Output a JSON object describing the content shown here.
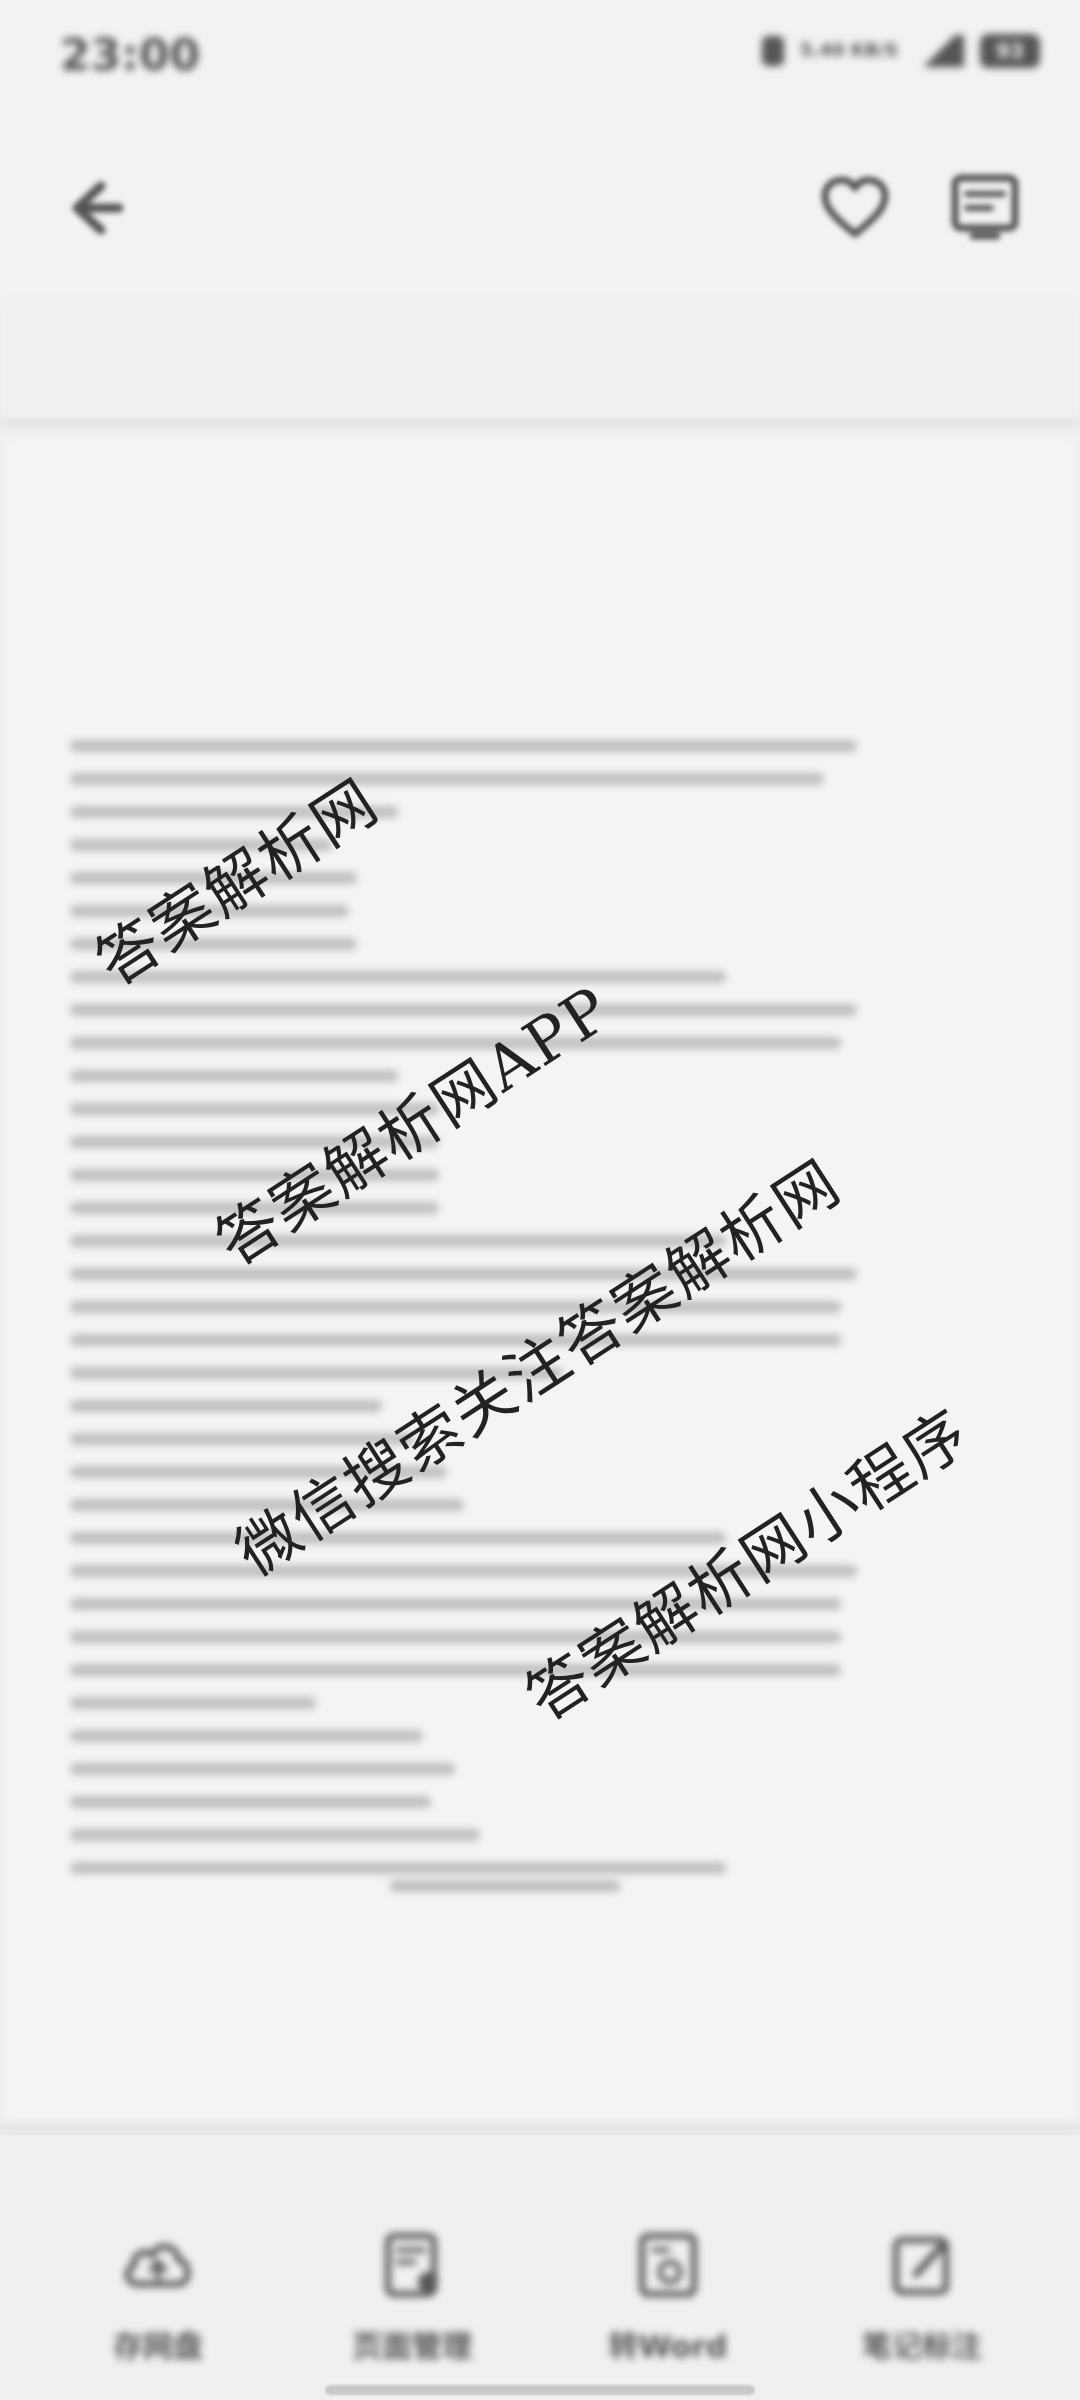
{
  "status_bar": {
    "time": "23:00",
    "network": "5.40 KB/S",
    "battery": "93"
  },
  "header": {
    "back_icon": "arrow-left-icon",
    "favorite_icon": "heart-icon",
    "menu_icon": "document-menu-icon"
  },
  "watermarks": [
    "答案解析网",
    "答案解析网APP",
    "微信搜索关注答案解析网",
    "答案解析网小程序"
  ],
  "toolbar": {
    "items": [
      {
        "label": "存网盘",
        "icon": "cloud-save-icon"
      },
      {
        "label": "页面管理",
        "icon": "page-manage-icon"
      },
      {
        "label": "转Word",
        "icon": "convert-word-icon"
      },
      {
        "label": "笔记标注",
        "icon": "edit-note-icon"
      }
    ]
  }
}
